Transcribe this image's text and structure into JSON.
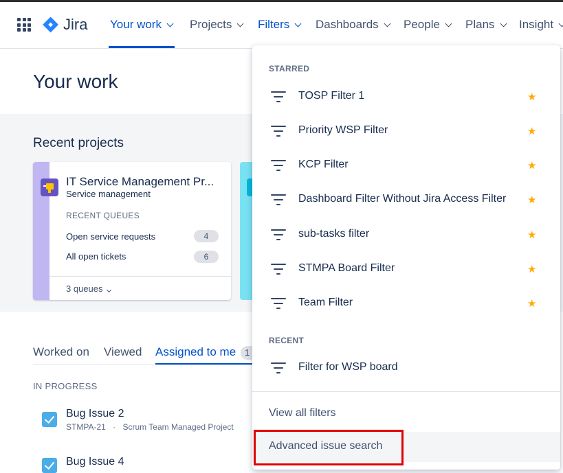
{
  "app": {
    "name": "Jira"
  },
  "nav": {
    "items": [
      {
        "label": "Your work",
        "active": true
      },
      {
        "label": "Projects"
      },
      {
        "label": "Filters"
      },
      {
        "label": "Dashboards"
      },
      {
        "label": "People"
      },
      {
        "label": "Plans"
      },
      {
        "label": "Insight"
      }
    ]
  },
  "page": {
    "title": "Your work"
  },
  "recent_projects": {
    "title": "Recent projects",
    "card": {
      "name": "IT Service Management Pr...",
      "type": "Service management",
      "queues_heading": "RECENT QUEUES",
      "queues": [
        {
          "label": "Open service requests",
          "count": "4"
        },
        {
          "label": "All open tickets",
          "count": "6"
        }
      ],
      "queues_link": "3 queues"
    }
  },
  "tabs": {
    "items": [
      {
        "label": "Worked on"
      },
      {
        "label": "Viewed"
      },
      {
        "label": "Assigned to me",
        "selected": true
      }
    ],
    "badge": "1"
  },
  "in_progress": {
    "heading": "IN PROGRESS",
    "issues": [
      {
        "title": "Bug Issue 2",
        "key": "STMPA-21",
        "separator": "·",
        "project": "Scrum Team Managed Project"
      },
      {
        "title": "Bug Issue 4"
      }
    ]
  },
  "filters_dropdown": {
    "starred_heading": "STARRED",
    "starred": [
      {
        "label": "TOSP Filter 1"
      },
      {
        "label": "Priority WSP Filter"
      },
      {
        "label": "KCP Filter"
      },
      {
        "label": "Dashboard Filter Without Jira Access Filter"
      },
      {
        "label": "sub-tasks filter"
      },
      {
        "label": "STMPA Board Filter"
      },
      {
        "label": "Team Filter"
      }
    ],
    "recent_heading": "RECENT",
    "recent": [
      {
        "label": "Filter for WSP board"
      }
    ],
    "view_all": "View all filters",
    "advanced_search": "Advanced issue search",
    "star_icon": "star-icon",
    "star_color": "#FFAB00"
  },
  "colors": {
    "accent": "#0052CC",
    "highlight_box": "#E00000"
  }
}
